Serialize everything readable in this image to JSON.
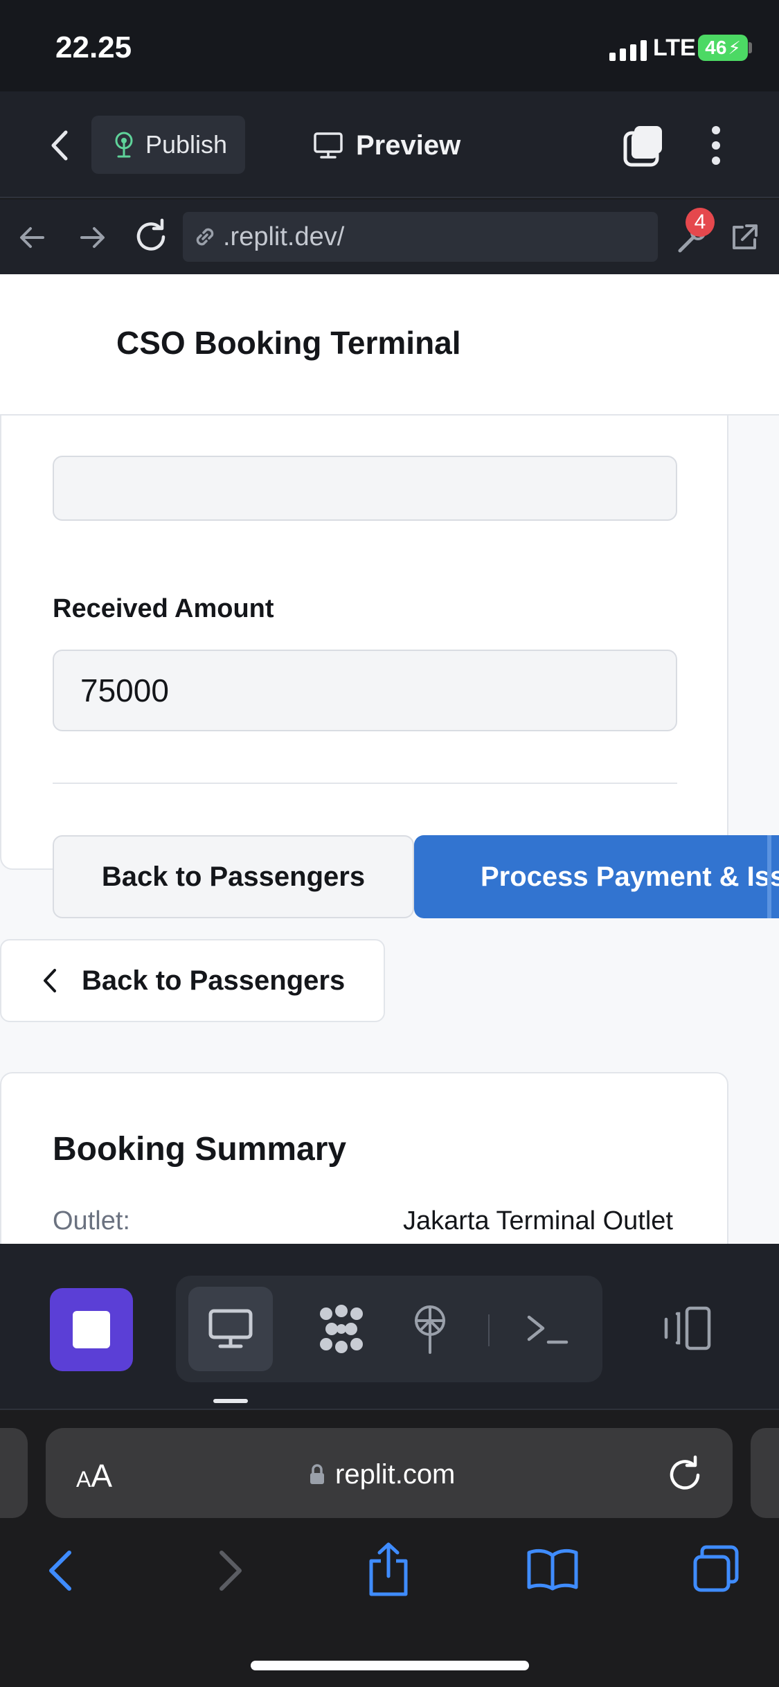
{
  "status_bar": {
    "time": "22.25",
    "network": "LTE",
    "battery": "46"
  },
  "replit_header": {
    "publish_label": "Publish",
    "preview_label": "Preview"
  },
  "url_bar": {
    "url": ".replit.dev/",
    "tools_badge_count": "4"
  },
  "app": {
    "title": "CSO Booking Terminal",
    "payment": {
      "received_label": "Received Amount",
      "received_value": "75000",
      "back_button": "Back to Passengers",
      "process_button": "Process Payment & Iss"
    },
    "back_passengers_button": "Back to Passengers",
    "summary": {
      "title": "Booking Summary",
      "outlet_label": "Outlet:",
      "outlet_value": "Jakarta Terminal Outlet"
    }
  },
  "replit_toolbar": {
    "tools": [
      "stop-icon",
      "preview-icon",
      "agent-icon",
      "deploy-icon",
      "shell-icon",
      "panels-icon"
    ]
  },
  "safari": {
    "text_size_label_large": "A",
    "text_size_label_small": "A",
    "address": "replit.com"
  },
  "colors": {
    "primary_button": "#3274d0",
    "stop_button": "#5b3fd6",
    "badge": "#e5484d",
    "battery": "#4cd964"
  }
}
